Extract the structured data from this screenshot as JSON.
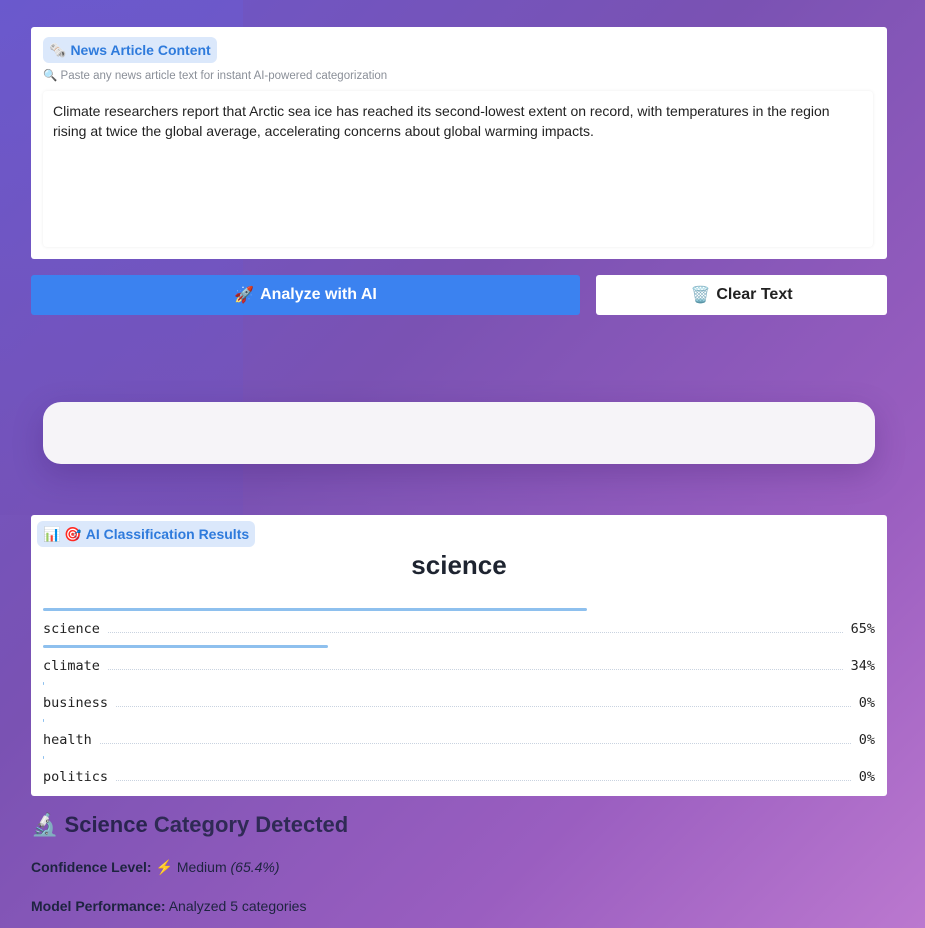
{
  "input": {
    "pill_icon": "🗞️",
    "pill_label": "News Article Content",
    "hint_icon": "🔍",
    "hint_text": "Paste any news article text for instant AI-powered categorization",
    "article_text": "Climate researchers report that Arctic sea ice has reached its second-lowest extent on record, with temperatures in the region rising at twice the global average, accelerating concerns about global warming impacts."
  },
  "buttons": {
    "analyze_icon": "🚀",
    "analyze_label": "Analyze with AI",
    "clear_icon": "🗑️",
    "clear_label": "Clear Text"
  },
  "results": {
    "pill_icons": "📊 🎯",
    "pill_label": "AI Classification Results",
    "top_label": "science",
    "rows": [
      {
        "label": "science",
        "value": 65,
        "text": "65%"
      },
      {
        "label": "climate",
        "value": 34,
        "text": "34%"
      },
      {
        "label": "business",
        "value": 0,
        "text": "0%"
      },
      {
        "label": "health",
        "value": 0,
        "text": "0%"
      },
      {
        "label": "politics",
        "value": 0,
        "text": "0%"
      }
    ]
  },
  "summary": {
    "detected_icon": "🔬",
    "detected_category": "Science",
    "detected_rest": "Category Detected",
    "confidence_label": "Confidence Level:",
    "confidence_icon": "⚡",
    "confidence_value": "Medium",
    "confidence_percent": "(65.4%)",
    "performance_label": "Model Performance:",
    "performance_value": "Analyzed 5 categories"
  },
  "colors": {
    "accent": "#3b82f0",
    "bar": "#8ec0ee",
    "pill_bg": "#dbe8fb",
    "pill_text": "#2f7bdc"
  }
}
